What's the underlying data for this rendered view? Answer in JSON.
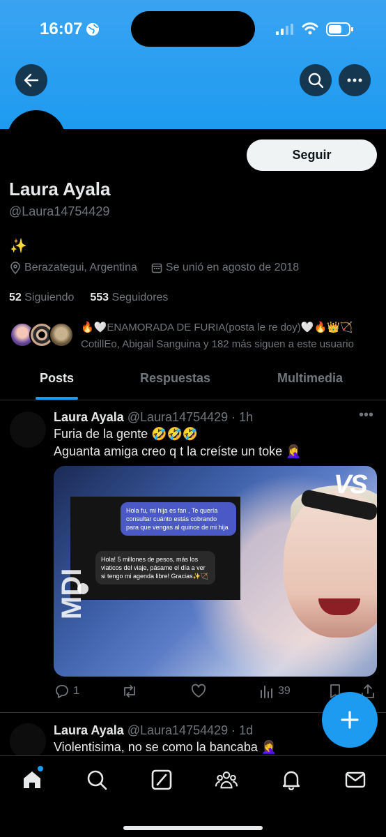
{
  "status_bar": {
    "time": "16:07"
  },
  "profile": {
    "name": "Laura Ayala",
    "handle": "@Laura14754429",
    "bio": "✨",
    "location": "Berazategui, Argentina",
    "joined": "Se unió en agosto de 2018",
    "following_count": "52",
    "following_label": "Siguiendo",
    "followers_count": "553",
    "followers_label": "Seguidores",
    "follow_button": "Seguir",
    "followers_you_know_line1": "🔥🤍ENAMORADA DE FURIA(posta le re doy)🤍🔥👑🏹",
    "followers_you_know_line2": "CotillEo, Abigail Sanguina y 182 más siguen a este usuario"
  },
  "tabs": [
    {
      "label": "Posts",
      "active": true
    },
    {
      "label": "Respuestas",
      "active": false
    },
    {
      "label": "Multimedia",
      "active": false
    }
  ],
  "tweets": [
    {
      "name": "Laura Ayala",
      "handle": "@Laura14754429",
      "time": "· 1h",
      "line1": "Furia de la gente 🤣🤣🤣",
      "line2": "Aguanta amiga creo q t la creíste un toke 🤦‍♀️",
      "media": {
        "logo": "VS",
        "side_word": "MDI",
        "chat_out": "Hola fu, mi hija es fan , Te quería consultar cuánto estás cobrando para que vengas al quince de mi hija",
        "chat_in": "Hola! 5 millones de pesos, más los viaticos del viaje, pásame el día a ver si tengo mi agenda libre! Gracias✨🏹"
      },
      "replies": "1",
      "retweets": "",
      "likes": "",
      "views": "39"
    },
    {
      "name": "Laura Ayala",
      "handle": "@Laura14754429",
      "time": "· 1d",
      "line1": "Violentisima, no se como la bancaba 🤦‍♀️"
    }
  ],
  "colors": {
    "accent": "#1d9bf0",
    "banner": "#1d9bf0",
    "muted": "#71767b"
  }
}
